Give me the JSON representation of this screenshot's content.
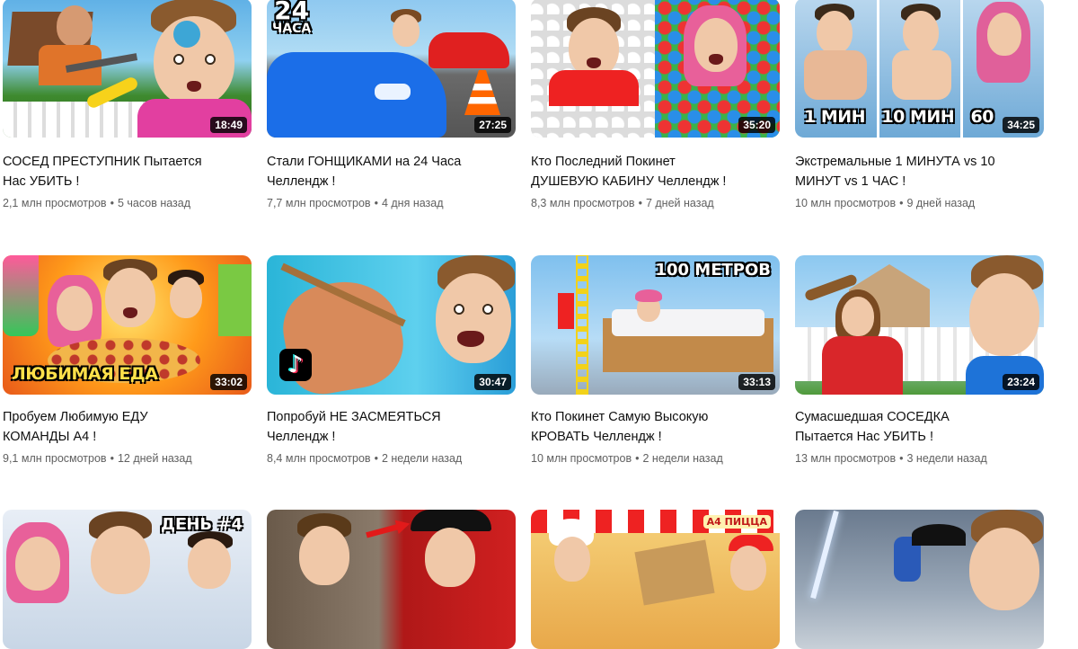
{
  "videos": [
    {
      "title": "СОСЕД ПРЕСТУПНИК Пытается\nНас УБИТЬ !",
      "views": "2,1 млн просмотров",
      "age": "5 часов назад",
      "duration": "18:49",
      "overlay": ""
    },
    {
      "title": "Стали ГОНЩИКАМИ на 24 Часа\nЧеллендж !",
      "views": "7,7 млн просмотров",
      "age": "4 дня назад",
      "duration": "27:25",
      "overlay": "24",
      "overlay_sub": "ЧАСА"
    },
    {
      "title": "Кто Последний Покинет\nДУШЕВУЮ КАБИНУ Челлендж !",
      "views": "8,3 млн просмотров",
      "age": "7 дней назад",
      "duration": "35:20",
      "overlay": ""
    },
    {
      "title": "Экстремальные 1 МИНУТА vs 10\nМИНУТ vs 1 ЧАС !",
      "views": "10 млн просмотров",
      "age": "9 дней назад",
      "duration": "34:25",
      "overlay": "1 МИН   10 МИН   60"
    },
    {
      "title": "Пробуем Любимую ЕДУ\nКОМАНДЫ А4 !",
      "views": "9,1 млн просмотров",
      "age": "12 дней назад",
      "duration": "33:02",
      "overlay": "ЛЮБИМАЯ ЕДА"
    },
    {
      "title": "Попробуй НЕ ЗАСМЕЯТЬСЯ\nЧеллендж !",
      "views": "8,4 млн просмотров",
      "age": "2 недели назад",
      "duration": "30:47",
      "overlay": ""
    },
    {
      "title": "Кто Покинет Самую Высокую\nКРОВАТЬ Челлендж !",
      "views": "10 млн просмотров",
      "age": "2 недели назад",
      "duration": "33:13",
      "overlay": "100 МЕТРОВ"
    },
    {
      "title": "Сумасшедшая СОСЕДКА\nПытается Нас УБИТЬ !",
      "views": "13 млн просмотров",
      "age": "3 недели назад",
      "duration": "23:24",
      "overlay": ""
    },
    {
      "title": "",
      "views": "",
      "age": "",
      "duration": "",
      "overlay": "ДЕНЬ #4"
    },
    {
      "title": "",
      "views": "",
      "age": "",
      "duration": "",
      "overlay": ""
    },
    {
      "title": "",
      "views": "",
      "age": "",
      "duration": "",
      "overlay": "A4 ПИЦЦА"
    },
    {
      "title": "",
      "views": "",
      "age": "",
      "duration": "",
      "overlay": ""
    }
  ],
  "separator": "•",
  "colors": {
    "meta_text": "#606060",
    "title_text": "#0f0f0f",
    "duration_bg": "#000000"
  },
  "icons": {
    "tiktok": "tiktok-logo-icon"
  }
}
